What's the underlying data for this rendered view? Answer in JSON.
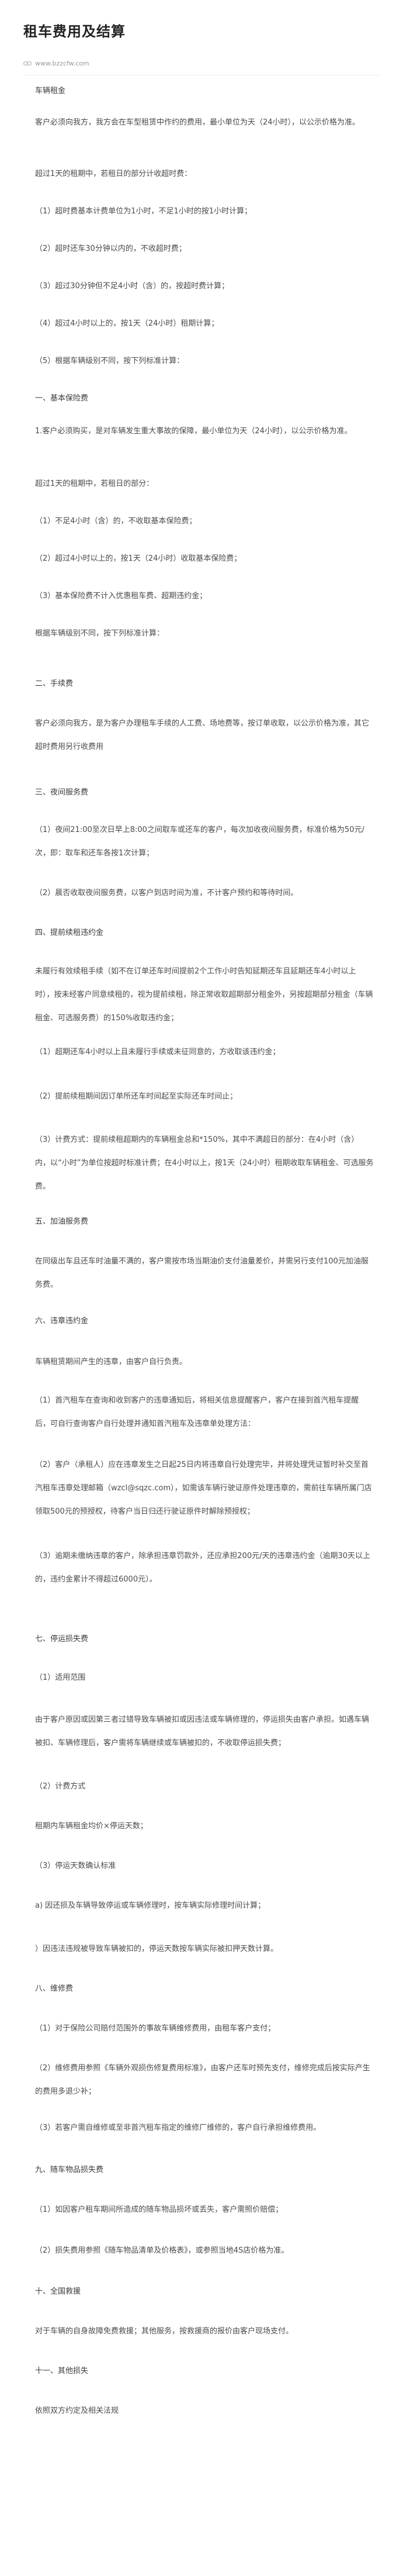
{
  "article": {
    "title": "租车费用及结算",
    "source": "www.bzzcfw.com",
    "paragraphs": [
      "车辆租金",
      "客户必须向我方，我方会在车型租赁中作约的费用，最小单位为天（24小时），以公示价格为准。",
      "超过1天的租期中，若租日的部分计收超时费：",
      "（1）超时费基本计费单位为1小时，不足1小时的按1小时计算；",
      "（2）超时还车30分钟以内的，不收超时费；",
      "（3）超过30分钟但不足4小时（含）的，按超时费计算；",
      "（4）超过4小时以上的，按1天（24小时）租期计算；",
      "（5）根据车辆级别不同，按下列标准计算：",
      "一、基本保险费",
      "1.客户必须购买，是对车辆发生重大事故的保障，最小单位为天（24小时），以公示价格为准。",
      "超过1天的租期中，若租日的部分：",
      "（1）不足4小时（含）的，不收取基本保险费；",
      "（2）超过4小时以上的，按1天（24小时）收取基本保险费；",
      "（3）基本保险费不计入优惠租车费、超期违约金；",
      "根据车辆级别不同，按下列标准计算：",
      "二、手续费",
      "客户必须向我方，是为客户办理租车手续的人工费、场地费等，按订单收取，以公示价格为准，其它超时费用另行收费用",
      "三、夜间服务费",
      "（1）夜间21:00至次日早上8:00之间取车或还车的客户，每次加收夜间服务费，标准价格为50元/次，即：取车和还车各按1次计算；",
      "（2）晨否收取夜间服务费，以客户到店时间为准，不计客户预约和等待时间。",
      "四、提前续租违约金",
      "未履行有效续租手续（如不在订单还车时间提前2个工作小时告知延期还车且延期还车4小时以上时），按未经客户同意续租的，视为提前续租，除正常收取超期部分租金外，另按超期部分租金（车辆租金、可选服务费）的150%收取违约金；",
      "（1）超期还车4小时以上且未履行手续或未征同意的，方收取该违约金；",
      "（2）提前续租期间因订单所还车时间起至实际还车时间止；",
      "（3）计费方式：提前续租超期内的车辆租金总和*150%，其中不满超日的部分：在4小时（含）内，以“小时”为单位按超时标准计费；在4小时以上，按1天（24小时）租期收取车辆租金、可选服务费。",
      "五、加油服务费",
      "在同级出车且还车时油量不满的，客户需按市场当期油价支付油量差价，并需另行支付100元加油服务费。",
      "六、违章违约金",
      "车辆租赁期间产生的违章，由客户自行负责。",
      "（1）首汽租车在查询和收到客户的违章通知后，将相关信息提醒客户，客户在接到首汽租车提醒后，可自行查询客户自行处理并通知首汽租车及违章单处理方法：",
      "（2）客户（承租人）应在违章发生之日起25日内将违章自行处理完毕，并将处理凭证暂时补交至首汽租车违章处理邮箱（wzcl@sqzc.com），如需该车辆行驶证原件处理违章的，需前往车辆所属门店领取500元的预授权，待客户当日归还行驶证原件时解除预授权；",
      "（3）逾期未缴纳违章的客户，除承担违章罚款外，还应承担200元/天的违章违约金（逾期30天以上的，违约金累计不得超过6000元）。",
      "七、停运损失费",
      "（1）适用范围",
      "由于客户原因或因第三者过错导致车辆被扣或因违法或车辆修理的，停运损失由客户承担。如遇车辆被扣、车辆修理后，客户需将车辆继续或车辆被扣的，不收取停运损失费；",
      "（2）计费方式",
      "租期内车辆租金均价×停运天数；",
      "（3）停运天数确认标准",
      "a) 因还损及车辆导致停运或车辆修理时，按车辆实际修理时间计算；",
      "）因违法违规被导致车辆被扣的，停运天数按车辆实际被扣押天数计算。",
      "八、维修费",
      "（1）对于保险公司赔付范围外的事故车辆维修费用，由租车客户支付；",
      "（2）维修费用参照《车辆外观损伤修复费用标准》，由客户还车时预先支付，维修完成后按实际产生的费用多退少补；",
      "（3）若客户需自维修或至非首汽租车指定的维修厂维修的，客户自行承担维修费用。",
      "九、随车物品损失费",
      "（1）如因客户租车期间所造成的随车物品损坏或丢失，客户需照价赔偿；",
      "（2）损失费用参照《随车物品清单及价格表》，或参照当地4S店价格为准。",
      "十、全国救援",
      "对于车辆的自身故障免费救援；其他服务，按救援商的报价由客户现场支付。",
      "十一、其他损失",
      "依照双方约定及相关法规"
    ]
  }
}
